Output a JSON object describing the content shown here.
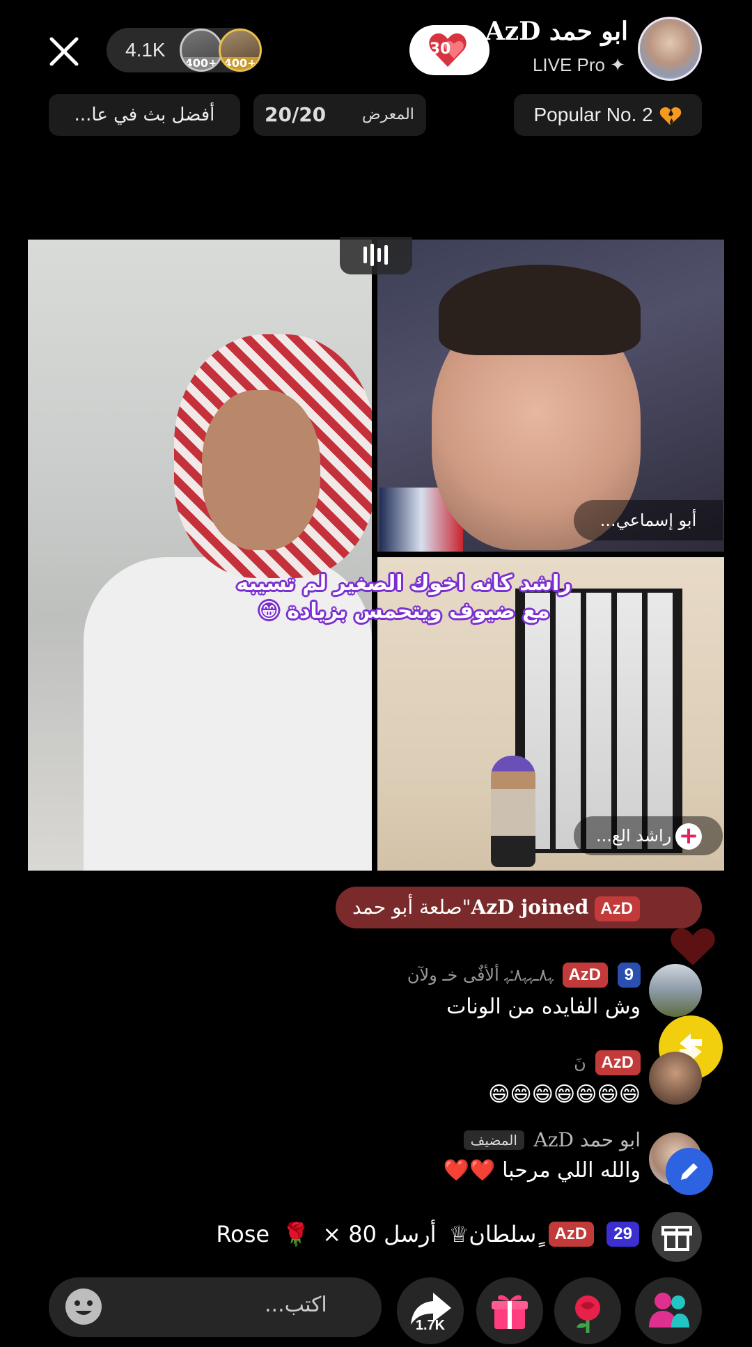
{
  "header": {
    "viewer_count": "4.1K",
    "top_viewers": [
      {
        "badge": "400+"
      },
      {
        "badge": "400+"
      }
    ],
    "hearts_count": "30",
    "host_name": "ابو حمد AzD",
    "host_subtitle": "LIVE Pro ✦"
  },
  "chips": {
    "best_live": "أفضل بث في عا...",
    "gallery_label": "المعرض",
    "gallery_count": "20/20",
    "popular": "Popular No. 2"
  },
  "video": {
    "guest_top_name": "أبو إسماعي...",
    "guest_bottom_name": "راشد الع...",
    "caption_line1": "راشد كانه اخوك الصغير لم تسيبه",
    "caption_line2": "مع ضيوف ويتحمس بزيادة 😁"
  },
  "chat": {
    "join_banner": {
      "badge": "AzD",
      "text_prefix": "AzD joined",
      "text_suffix": "\"صلعة أبو حمد"
    },
    "messages": [
      {
        "level": "9",
        "badge": "AzD",
        "username": "ﮩ٨ـﮩﮩ٨ـ۟ﮩ ألأفٌى خـ ولآن",
        "text": "وش الفايده من الونات"
      },
      {
        "badge": "AzD",
        "username": "نَ",
        "text": "😄😄😄😄😄😄😄"
      },
      {
        "username": "ابو حمد AzD",
        "host_tag": "المضيف",
        "text": "والله اللي مرحبا ❤️❤️"
      }
    ],
    "gift": {
      "level": "29",
      "badge": "AzD",
      "sender": "ٍسلطان♕",
      "action": "أرسل Rose",
      "emoji": "🌹",
      "count": "× 80"
    }
  },
  "bottom_bar": {
    "comment_placeholder": "اكتب...",
    "share_count": "1.7K"
  },
  "colors": {
    "background": "#000000",
    "accent_red": "#c23a3a",
    "join_banner": "#7a2a2a",
    "caption_outline": "#7b2fd0",
    "repost_yellow": "#f2cf0e",
    "gift_pink": "#ff3d7f",
    "people_magenta": "#e0308f",
    "people_teal": "#22c4c4"
  },
  "icons": [
    "close-icon",
    "hearts-icon",
    "sparkle-icon",
    "heart-broken-icon",
    "audio-bars-icon",
    "plus-icon",
    "floating-heart-icon",
    "repost-icon",
    "edit-icon",
    "gift-box-icon",
    "emoji-icon",
    "share-icon",
    "gift-icon",
    "rose-icon",
    "people-icon"
  ]
}
